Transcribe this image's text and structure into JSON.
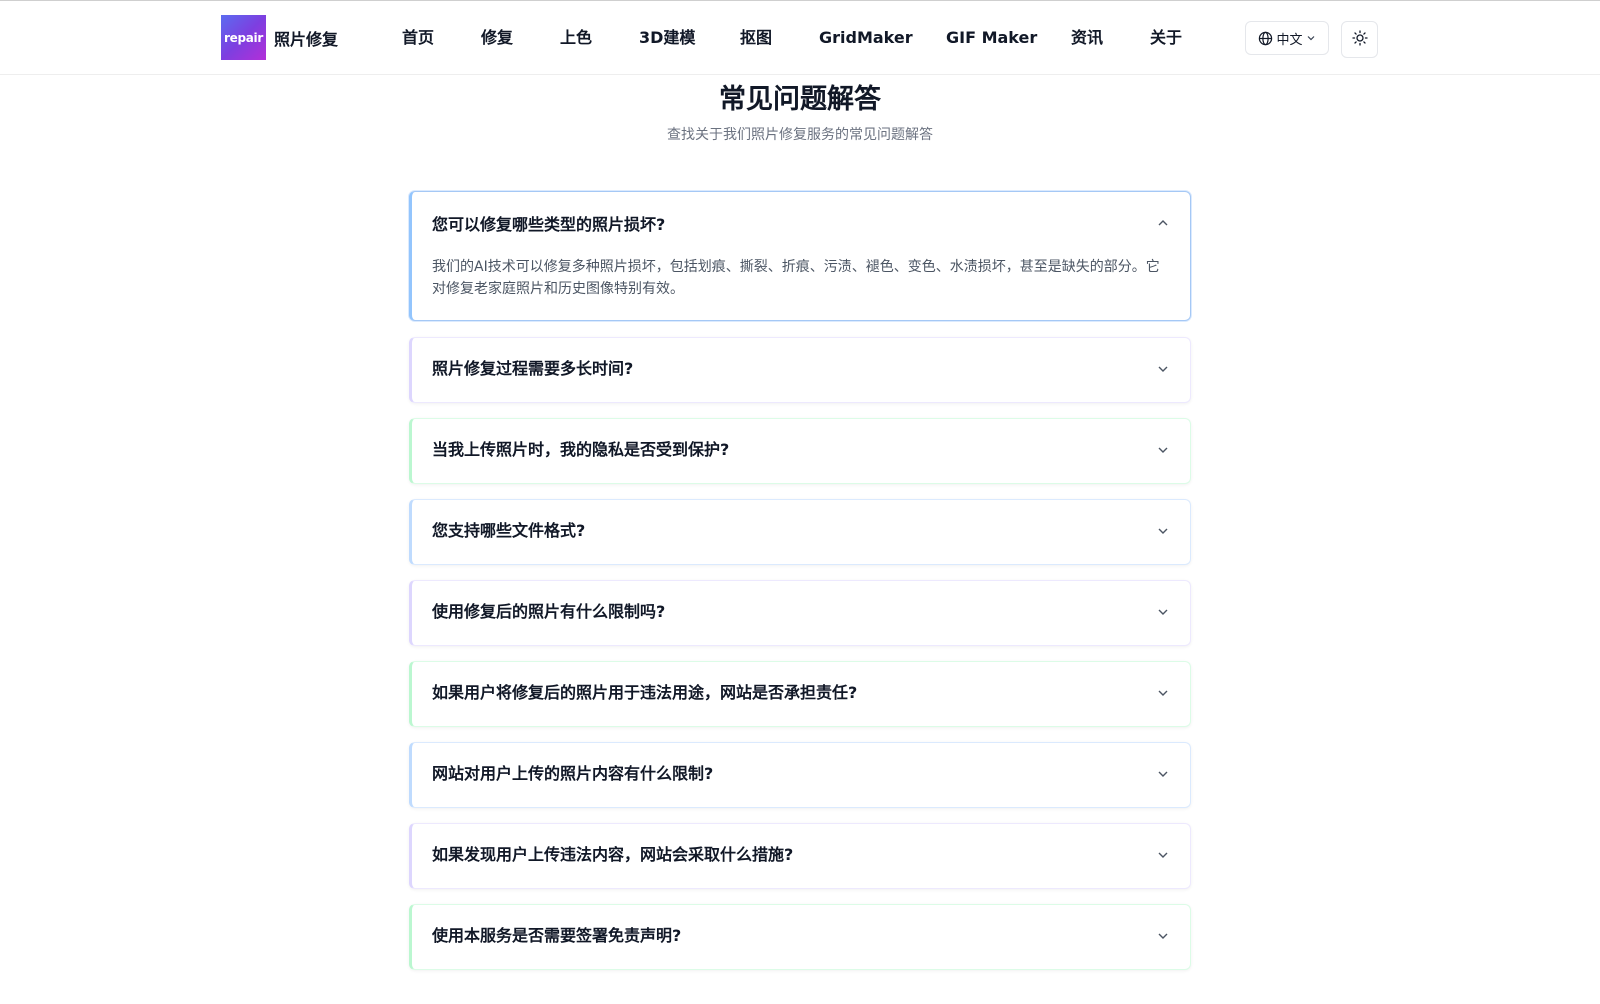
{
  "brand": {
    "logo_text": "repair",
    "name": "照片修复"
  },
  "nav": {
    "items": [
      {
        "label": "首页"
      },
      {
        "label": "修复"
      },
      {
        "label": "上色"
      },
      {
        "label": "3D建模"
      },
      {
        "label": "抠图"
      },
      {
        "label": "GridMaker"
      },
      {
        "label": "GIF Maker"
      },
      {
        "label": "资讯"
      },
      {
        "label": "关于"
      }
    ],
    "language_label": "中文"
  },
  "faq": {
    "title": "常见问题解答",
    "subtitle": "查找关于我们照片修复服务的常见问题解答",
    "items": [
      {
        "question": "您可以修复哪些类型的照片损坏?",
        "answer": "我们的AI技术可以修复多种照片损坏，包括划痕、撕裂、折痕、污渍、褪色、变色、水渍损坏，甚至是缺失的部分。它对修复老家庭照片和历史图像特别有效。",
        "expanded": true
      },
      {
        "question": "照片修复过程需要多长时间?",
        "expanded": false
      },
      {
        "question": "当我上传照片时，我的隐私是否受到保护?",
        "expanded": false
      },
      {
        "question": "您支持哪些文件格式?",
        "expanded": false
      },
      {
        "question": "使用修复后的照片有什么限制吗?",
        "expanded": false
      },
      {
        "question": "如果用户将修复后的照片用于违法用途，网站是否承担责任?",
        "expanded": false
      },
      {
        "question": "网站对用户上传的照片内容有什么限制?",
        "expanded": false
      },
      {
        "question": "如果发现用户上传违法内容，网站会采取什么措施?",
        "expanded": false
      },
      {
        "question": "使用本服务是否需要签署免责声明?",
        "expanded": false
      }
    ]
  },
  "colors": {
    "logo_gradient_start": "#5b6cf0",
    "logo_gradient_end": "#b32fd8",
    "text_primary": "#111827",
    "text_muted": "#6b7280",
    "open_item_border": "#a5c8f5"
  },
  "icons": {
    "language": "globe-icon",
    "theme": "sun-icon",
    "expanded": "chevron-up-icon",
    "collapsed": "chevron-down-icon"
  }
}
